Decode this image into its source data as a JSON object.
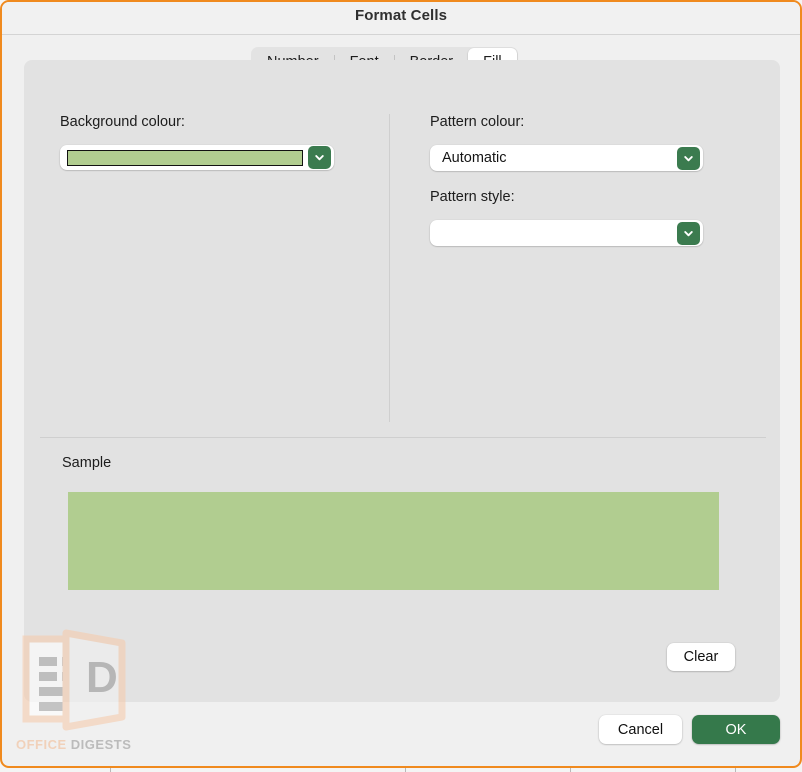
{
  "window": {
    "title": "Format Cells",
    "border_color": "#f08a1e"
  },
  "tabs": [
    {
      "label": "Number",
      "active": false
    },
    {
      "label": "Font",
      "active": false
    },
    {
      "label": "Border",
      "active": false
    },
    {
      "label": "Fill",
      "active": true
    }
  ],
  "fill_panel": {
    "background_colour": {
      "label": "Background colour:",
      "value": "",
      "swatch_color": "#b1cd90",
      "dropdown_icon": "chevron-down-icon"
    },
    "pattern_colour": {
      "label": "Pattern colour:",
      "value": "Automatic",
      "dropdown_icon": "chevron-down-icon"
    },
    "pattern_style": {
      "label": "Pattern style:",
      "value": "",
      "dropdown_icon": "chevron-down-icon"
    },
    "sample": {
      "label": "Sample",
      "fill_color": "#b1cd90"
    },
    "clear_button": "Clear"
  },
  "footer": {
    "cancel_button": "Cancel",
    "ok_button": "OK",
    "accent_color": "#35794b"
  },
  "watermark": {
    "icon": "document-logo-icon",
    "letter": "D",
    "text_primary": "OFFICE",
    "text_secondary": "DIGESTS"
  }
}
